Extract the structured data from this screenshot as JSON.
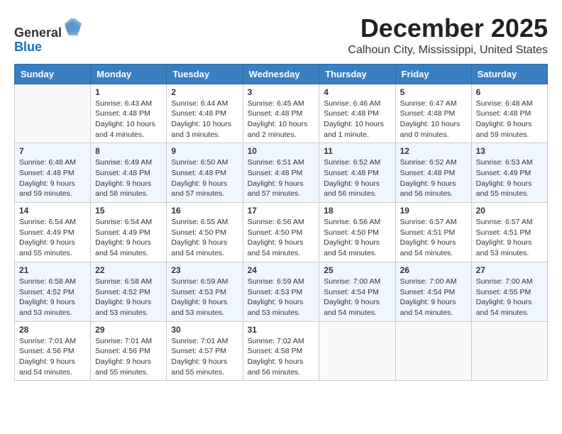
{
  "header": {
    "logo": {
      "line1": "General",
      "line2": "Blue"
    },
    "title": "December 2025",
    "subtitle": "Calhoun City, Mississippi, United States"
  },
  "calendar": {
    "weekdays": [
      "Sunday",
      "Monday",
      "Tuesday",
      "Wednesday",
      "Thursday",
      "Friday",
      "Saturday"
    ],
    "weeks": [
      [
        {
          "day": "",
          "info": ""
        },
        {
          "day": "1",
          "info": "Sunrise: 6:43 AM\nSunset: 4:48 PM\nDaylight: 10 hours\nand 4 minutes."
        },
        {
          "day": "2",
          "info": "Sunrise: 6:44 AM\nSunset: 4:48 PM\nDaylight: 10 hours\nand 3 minutes."
        },
        {
          "day": "3",
          "info": "Sunrise: 6:45 AM\nSunset: 4:48 PM\nDaylight: 10 hours\nand 2 minutes."
        },
        {
          "day": "4",
          "info": "Sunrise: 6:46 AM\nSunset: 4:48 PM\nDaylight: 10 hours\nand 1 minute."
        },
        {
          "day": "5",
          "info": "Sunrise: 6:47 AM\nSunset: 4:48 PM\nDaylight: 10 hours\nand 0 minutes."
        },
        {
          "day": "6",
          "info": "Sunrise: 6:48 AM\nSunset: 4:48 PM\nDaylight: 9 hours\nand 59 minutes."
        }
      ],
      [
        {
          "day": "7",
          "info": "Sunrise: 6:48 AM\nSunset: 4:48 PM\nDaylight: 9 hours\nand 59 minutes."
        },
        {
          "day": "8",
          "info": "Sunrise: 6:49 AM\nSunset: 4:48 PM\nDaylight: 9 hours\nand 58 minutes."
        },
        {
          "day": "9",
          "info": "Sunrise: 6:50 AM\nSunset: 4:48 PM\nDaylight: 9 hours\nand 57 minutes."
        },
        {
          "day": "10",
          "info": "Sunrise: 6:51 AM\nSunset: 4:48 PM\nDaylight: 9 hours\nand 57 minutes."
        },
        {
          "day": "11",
          "info": "Sunrise: 6:52 AM\nSunset: 4:48 PM\nDaylight: 9 hours\nand 56 minutes."
        },
        {
          "day": "12",
          "info": "Sunrise: 6:52 AM\nSunset: 4:48 PM\nDaylight: 9 hours\nand 56 minutes."
        },
        {
          "day": "13",
          "info": "Sunrise: 6:53 AM\nSunset: 4:49 PM\nDaylight: 9 hours\nand 55 minutes."
        }
      ],
      [
        {
          "day": "14",
          "info": "Sunrise: 6:54 AM\nSunset: 4:49 PM\nDaylight: 9 hours\nand 55 minutes."
        },
        {
          "day": "15",
          "info": "Sunrise: 6:54 AM\nSunset: 4:49 PM\nDaylight: 9 hours\nand 54 minutes."
        },
        {
          "day": "16",
          "info": "Sunrise: 6:55 AM\nSunset: 4:50 PM\nDaylight: 9 hours\nand 54 minutes."
        },
        {
          "day": "17",
          "info": "Sunrise: 6:56 AM\nSunset: 4:50 PM\nDaylight: 9 hours\nand 54 minutes."
        },
        {
          "day": "18",
          "info": "Sunrise: 6:56 AM\nSunset: 4:50 PM\nDaylight: 9 hours\nand 54 minutes."
        },
        {
          "day": "19",
          "info": "Sunrise: 6:57 AM\nSunset: 4:51 PM\nDaylight: 9 hours\nand 54 minutes."
        },
        {
          "day": "20",
          "info": "Sunrise: 6:57 AM\nSunset: 4:51 PM\nDaylight: 9 hours\nand 53 minutes."
        }
      ],
      [
        {
          "day": "21",
          "info": "Sunrise: 6:58 AM\nSunset: 4:52 PM\nDaylight: 9 hours\nand 53 minutes."
        },
        {
          "day": "22",
          "info": "Sunrise: 6:58 AM\nSunset: 4:52 PM\nDaylight: 9 hours\nand 53 minutes."
        },
        {
          "day": "23",
          "info": "Sunrise: 6:59 AM\nSunset: 4:53 PM\nDaylight: 9 hours\nand 53 minutes."
        },
        {
          "day": "24",
          "info": "Sunrise: 6:59 AM\nSunset: 4:53 PM\nDaylight: 9 hours\nand 53 minutes."
        },
        {
          "day": "25",
          "info": "Sunrise: 7:00 AM\nSunset: 4:54 PM\nDaylight: 9 hours\nand 54 minutes."
        },
        {
          "day": "26",
          "info": "Sunrise: 7:00 AM\nSunset: 4:54 PM\nDaylight: 9 hours\nand 54 minutes."
        },
        {
          "day": "27",
          "info": "Sunrise: 7:00 AM\nSunset: 4:55 PM\nDaylight: 9 hours\nand 54 minutes."
        }
      ],
      [
        {
          "day": "28",
          "info": "Sunrise: 7:01 AM\nSunset: 4:56 PM\nDaylight: 9 hours\nand 54 minutes."
        },
        {
          "day": "29",
          "info": "Sunrise: 7:01 AM\nSunset: 4:56 PM\nDaylight: 9 hours\nand 55 minutes."
        },
        {
          "day": "30",
          "info": "Sunrise: 7:01 AM\nSunset: 4:57 PM\nDaylight: 9 hours\nand 55 minutes."
        },
        {
          "day": "31",
          "info": "Sunrise: 7:02 AM\nSunset: 4:58 PM\nDaylight: 9 hours\nand 56 minutes."
        },
        {
          "day": "",
          "info": ""
        },
        {
          "day": "",
          "info": ""
        },
        {
          "day": "",
          "info": ""
        }
      ]
    ]
  }
}
